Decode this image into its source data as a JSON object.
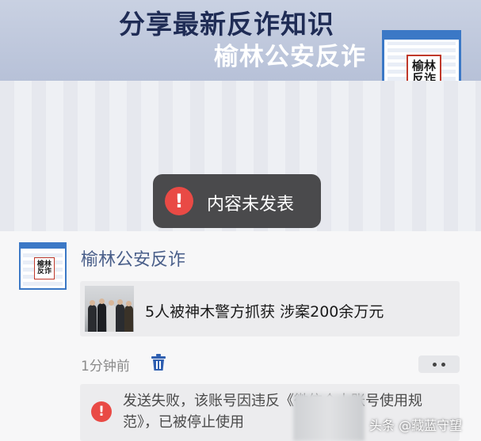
{
  "header": {
    "line1": "分享最新反诈知识",
    "line2": "榆林公安反诈"
  },
  "stamp": {
    "line1": "榆林",
    "line2": "反诈"
  },
  "toast": {
    "icon": "exclamation-icon",
    "text": "内容未发表"
  },
  "account": {
    "name": "榆林公安反诈"
  },
  "article": {
    "title": "5人被神木警方抓获 涉案200余万元"
  },
  "meta": {
    "time": "1分钟前"
  },
  "error": {
    "icon": "exclamation-icon",
    "message": "发送失败，该账号因违反《微信个人账号使用规范》，已被停止使用"
  },
  "watermark": {
    "text": "头条 @藏蓝守望"
  },
  "colors": {
    "error_red": "#e94a45",
    "account_blue": "#4a5f8a",
    "header_bg": "#b7c1d8"
  }
}
